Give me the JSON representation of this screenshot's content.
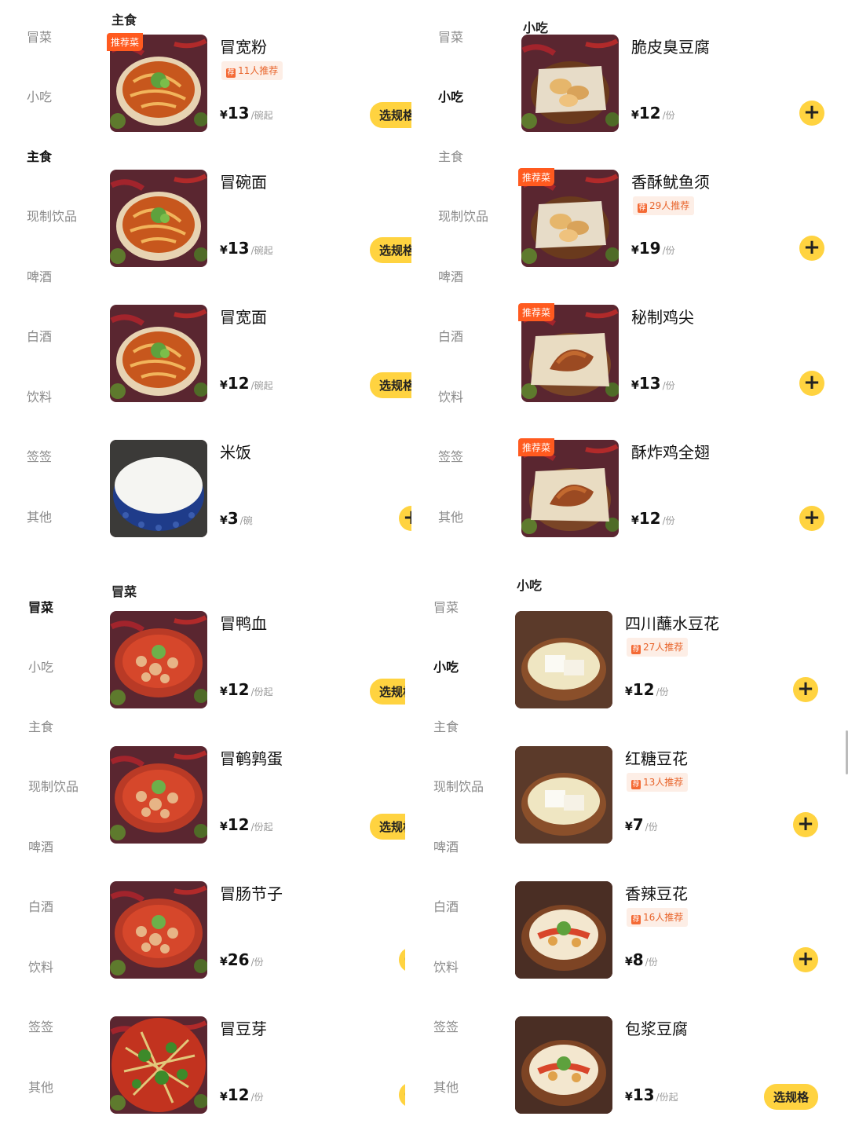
{
  "panels": [
    {
      "active_category": "主食",
      "categories": [
        "冒菜",
        "小吃",
        "主食",
        "现制饮品",
        "啤酒",
        "白酒",
        "饮料",
        "签签",
        "其他"
      ],
      "section_title": "主食",
      "items": [
        {
          "name": "冒宽粉",
          "badge": "推荐菜",
          "rec": "11人推荐",
          "price": "13",
          "unit": "/碗起",
          "action": "选规格",
          "img": "noodle"
        },
        {
          "name": "冒碗面",
          "badge": "",
          "rec": "",
          "price": "13",
          "unit": "/碗起",
          "action": "选规格",
          "img": "noodle"
        },
        {
          "name": "冒宽面",
          "badge": "",
          "rec": "",
          "price": "12",
          "unit": "/碗起",
          "action": "选规格",
          "img": "noodle"
        },
        {
          "name": "米饭",
          "badge": "",
          "rec": "",
          "price": "3",
          "unit": "/碗",
          "action": "+",
          "img": "rice"
        }
      ]
    },
    {
      "active_category": "小吃",
      "categories": [
        "冒菜",
        "小吃",
        "主食",
        "现制饮品",
        "啤酒",
        "白酒",
        "饮料",
        "签签",
        "其他"
      ],
      "section_title": "小吃",
      "items": [
        {
          "name": "脆皮臭豆腐",
          "badge": "",
          "rec": "",
          "price": "12",
          "unit": "/份",
          "action": "+",
          "img": "fried"
        },
        {
          "name": "香酥鱿鱼须",
          "badge": "推荐菜",
          "rec": "29人推荐",
          "price": "19",
          "unit": "/份",
          "action": "+",
          "img": "fried"
        },
        {
          "name": "秘制鸡尖",
          "badge": "推荐菜",
          "rec": "",
          "price": "13",
          "unit": "/份",
          "action": "+",
          "img": "chicken"
        },
        {
          "name": "酥炸鸡全翅",
          "badge": "推荐菜",
          "rec": "",
          "price": "12",
          "unit": "/份",
          "action": "+",
          "img": "chicken"
        }
      ]
    },
    {
      "active_category": "冒菜",
      "categories": [
        "冒菜",
        "小吃",
        "主食",
        "现制饮品",
        "啤酒",
        "白酒",
        "饮料",
        "签签",
        "其他"
      ],
      "section_title": "冒菜",
      "items": [
        {
          "name": "冒鸭血",
          "badge": "",
          "rec": "",
          "price": "12",
          "unit": "/份起",
          "action": "选规格",
          "img": "redsoup"
        },
        {
          "name": "冒鹌鹑蛋",
          "badge": "",
          "rec": "",
          "price": "12",
          "unit": "/份起",
          "action": "选规格",
          "img": "redsoup"
        },
        {
          "name": "冒肠节子",
          "badge": "",
          "rec": "",
          "price": "26",
          "unit": "/份",
          "action": "+",
          "img": "redsoup"
        },
        {
          "name": "冒豆芽",
          "badge": "",
          "rec": "",
          "price": "12",
          "unit": "/份",
          "action": "+",
          "img": "sprouts"
        }
      ]
    },
    {
      "active_category": "小吃",
      "categories": [
        "冒菜",
        "小吃",
        "主食",
        "现制饮品",
        "啤酒",
        "白酒",
        "饮料",
        "签签",
        "其他"
      ],
      "section_title": "小吃",
      "items": [
        {
          "name": "四川蘸水豆花",
          "badge": "",
          "rec": "27人推荐",
          "price": "12",
          "unit": "/份",
          "action": "+",
          "img": "tofu"
        },
        {
          "name": "红糖豆花",
          "badge": "",
          "rec": "13人推荐",
          "price": "7",
          "unit": "/份",
          "action": "+",
          "img": "tofu"
        },
        {
          "name": "香辣豆花",
          "badge": "",
          "rec": "16人推荐",
          "price": "8",
          "unit": "/份",
          "action": "+",
          "img": "spicytofu"
        },
        {
          "name": "包浆豆腐",
          "badge": "",
          "rec": "",
          "price": "13",
          "unit": "/份起",
          "action": "选规格",
          "img": "spicytofu"
        }
      ]
    }
  ],
  "currency_symbol": "¥",
  "colors": {
    "accent": "#ffd340",
    "badge": "#ff5a1f",
    "rec_text": "#e8642b"
  }
}
